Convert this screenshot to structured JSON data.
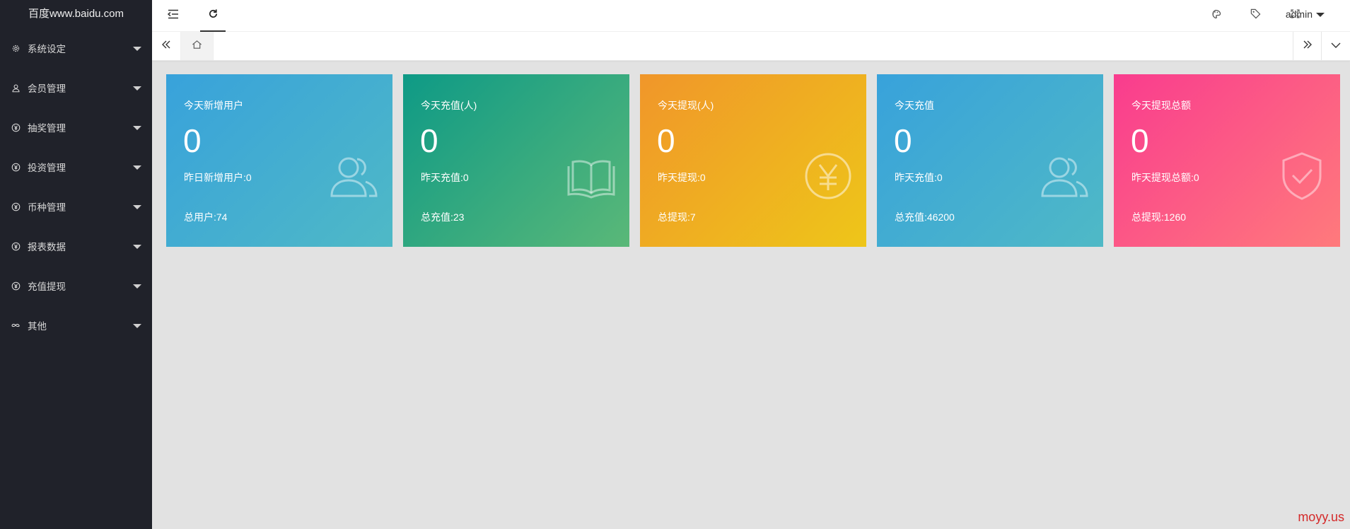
{
  "sidebar": {
    "logo": "百度www.baidu.com",
    "items": [
      {
        "label": "系统设定",
        "icon": "gear-icon"
      },
      {
        "label": "会员管理",
        "icon": "user-icon"
      },
      {
        "label": "抽奖管理",
        "icon": "yen-circle-icon"
      },
      {
        "label": "投资管理",
        "icon": "yen-circle-icon"
      },
      {
        "label": "币种管理",
        "icon": "yen-circle-icon"
      },
      {
        "label": "报表数据",
        "icon": "yen-circle-icon"
      },
      {
        "label": "充值提现",
        "icon": "yen-circle-icon"
      },
      {
        "label": "其他",
        "icon": "infinity-icon"
      }
    ]
  },
  "header": {
    "user": "admin",
    "icons": [
      "menu-fold-icon",
      "refresh-icon",
      "theme-palette-icon",
      "tag-icon",
      "fullscreen-icon"
    ]
  },
  "tabs": {
    "home_icon": "home-icon"
  },
  "cards": [
    {
      "title": "今天新增用户",
      "value": "0",
      "yesterday": "昨日新增用户:0",
      "total": "总用户:74",
      "icon": "users-icon",
      "gradient": [
        "#38a2db",
        "#4fb9c6"
      ]
    },
    {
      "title": "今天充值(人)",
      "value": "0",
      "yesterday": "昨天充值:0",
      "total": "总充值:23",
      "icon": "book-icon",
      "gradient": [
        "#0e9a86",
        "#5ab878"
      ]
    },
    {
      "title": "今天提现(人)",
      "value": "0",
      "yesterday": "昨天提现:0",
      "total": "总提现:7",
      "icon": "yen-circle-icon",
      "gradient": [
        "#f0962a",
        "#eec619"
      ]
    },
    {
      "title": "今天充值",
      "value": "0",
      "yesterday": "昨天充值:0",
      "total": "总充值:46200",
      "icon": "users-icon",
      "gradient": [
        "#38a2db",
        "#4fb9c6"
      ]
    },
    {
      "title": "今天提现总额",
      "value": "0",
      "yesterday": "昨天提现总额:0",
      "total": "总提现:1260",
      "icon": "shield-check-icon",
      "gradient": [
        "#f93c8e",
        "#ff7a7c"
      ]
    }
  ],
  "watermark": "moyy.us"
}
